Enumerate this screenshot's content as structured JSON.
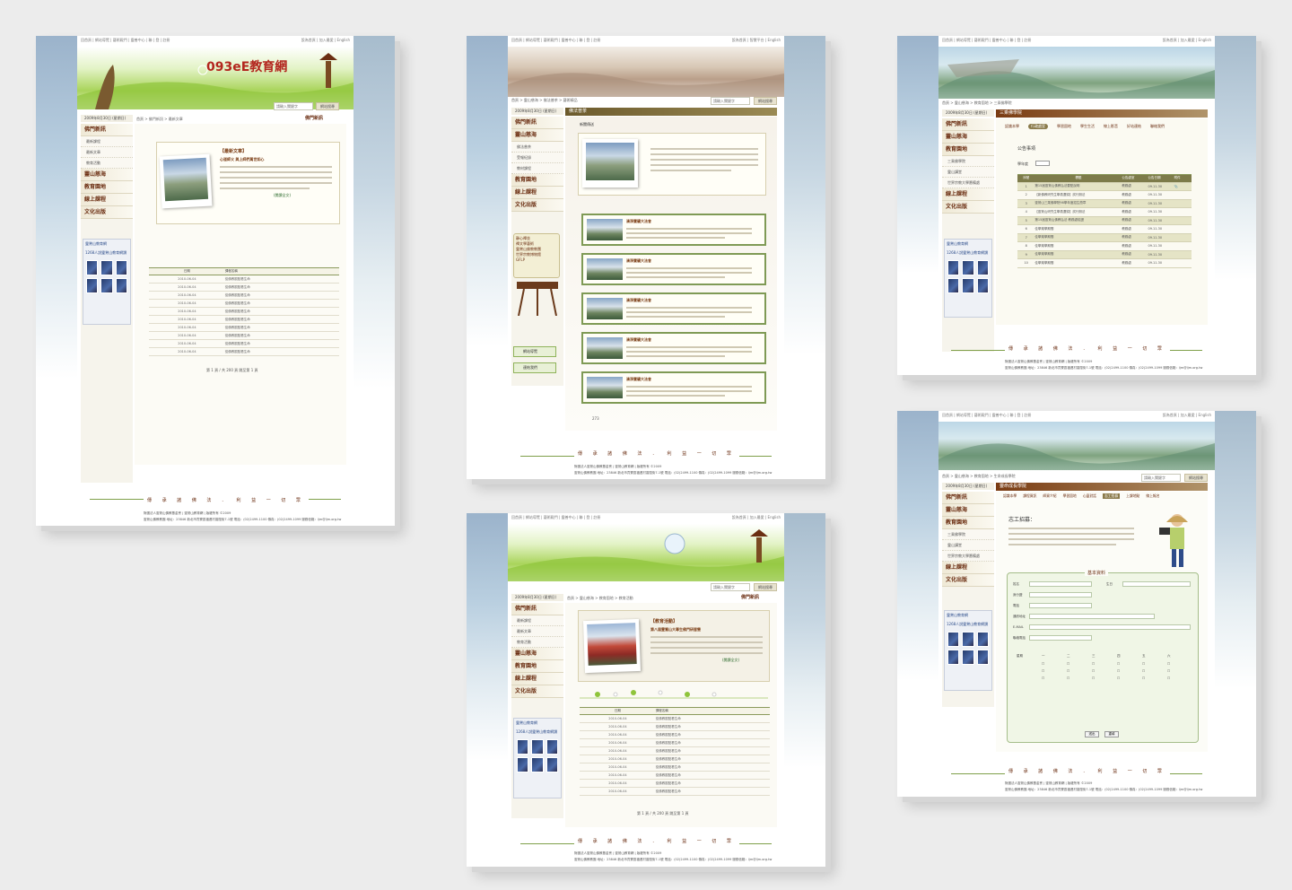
{
  "topnav": {
    "links": "回首頁 | 網站導覽 | 藝術殿門 | 靈善中心 | 聯 | 登 | 註冊",
    "links_short": "回首頁 | 網站導覽 | 藝術殿門 | 靈善中心 | 聯 | 登 | 註冊",
    "right": "設為首頁 | 加入最愛 | English",
    "right_alt": "設為首頁 | 智慧平台 | English"
  },
  "site": {
    "logo_text": "093eE教育網"
  },
  "search": {
    "placeholder": "請輸入關鍵字",
    "button": "網站搜尋"
  },
  "date": "2009年8月30日 (星期日)",
  "sidebar": {
    "menu1": "佛門新訊",
    "sub1": [
      "最新課程",
      "最新文章",
      "教育活動"
    ],
    "menu2": "靈山慈海",
    "menu3": "教育園地",
    "menu4": "線上課程",
    "menu5": "文化出版"
  },
  "facebook": {
    "title": "靈鷲山教育網",
    "sub": "Facebook",
    "like": "讚",
    "fans": "1268人說靈鷲山教育網讚",
    "fan_name": "有緣的"
  },
  "page1": {
    "crumb": "首頁 > 佛門新訊 > 最新文章",
    "badge": "佛門新訊",
    "article_title": "【最新文章】",
    "article_sub": "心道師父 與上師們萬世如心",
    "more": "(閱讀全文)",
    "table_head": [
      "日期",
      "課程名稱"
    ],
    "rows": [
      [
        "2010-06-04",
        "從佛教觀點看生命"
      ],
      [
        "2010-06-04",
        "從佛教觀點看生命"
      ],
      [
        "2010-06-04",
        "從佛教觀點看生命"
      ],
      [
        "2010-06-04",
        "從佛教觀點看生命"
      ],
      [
        "2010-06-04",
        "從佛教觀點看生命"
      ],
      [
        "2010-06-04",
        "從佛教觀點看生命"
      ],
      [
        "2010-06-04",
        "從佛教觀點看生命"
      ],
      [
        "2010-06-04",
        "從佛教觀點看生命"
      ],
      [
        "2010-06-04",
        "從佛教觀點看生命"
      ],
      [
        "2010-06-04",
        "從佛教觀點看生命"
      ]
    ],
    "pager": "第 1 頁 / 共 200 頁     跳至第 1 頁"
  },
  "page2": {
    "crumb": "首頁 > 靈山慈海 > 佛法普茶 > 藝術精品",
    "tab": "佛法普茶",
    "subhead": "新聞傳送",
    "sub_menu": [
      "佛法普茶",
      "受報紀錄",
      "教材課程"
    ],
    "news_title": "清淨寶礦大法會",
    "side_notes": [
      "靜心禪坐",
      "禪文學藝術",
      "靈鷲山佛教教團",
      "世界宗教博物館",
      "GFLP"
    ],
    "buttons": [
      "網站導覽",
      "連結我們"
    ],
    "rows_count": "273"
  },
  "page3": {
    "crumb": "首頁 > 靈山慈海 > 教育園地 > 三乘佛學院",
    "tab": "三乘佛學院",
    "tabs": [
      "認識本學",
      "行政處室",
      "學習園地",
      "學生生活",
      "線上影音",
      "好站連結",
      "聯絡我們"
    ],
    "section": "公告事項",
    "filter_label": "學年度",
    "side_menu": [
      "三乘佛學院",
      "靈山講堂",
      "世界宗教大學籌備處"
    ],
    "table_head": [
      "序號",
      "標題",
      "公告處室",
      "公告日期",
      "附件"
    ],
    "rows": [
      [
        "1",
        "第15屆靈鷲山佛教弘法要點說明",
        "教務處",
        "09.11.30"
      ],
      [
        "2",
        "【新佛教研究生學員選錄】試行辦法",
        "教務處",
        "09.11.30"
      ],
      [
        "3",
        "靈鷲山三乘佛學院98學年度招生簡章",
        "教務處",
        "09.11.30"
      ],
      [
        "4",
        "【靈鷲山研究生學員選錄】試行辦法",
        "教務處",
        "09.11.30"
      ],
      [
        "5",
        "第15屆靈鷲山佛教弘法 教務處檢證",
        "教務處",
        "09.11.30"
      ],
      [
        "6",
        "佳學樂學期間",
        "教務處",
        "09.11.30"
      ],
      [
        "7",
        "佳學樂學期間",
        "教務處",
        "09.11.30"
      ],
      [
        "8",
        "佳學樂學期間",
        "教務處",
        "09.11.30"
      ],
      [
        "9",
        "佳學樂學期間",
        "教務處",
        "09.11.30"
      ],
      [
        "10",
        "佳學樂學期間",
        "教務處",
        "09.11.30"
      ]
    ]
  },
  "page4": {
    "crumb": "首頁 > 靈山慈海 > 教育園地 > 教育活動",
    "badge": "佛門新訊",
    "article_title": "【教育活動】",
    "article_sub": "第八屆靈鷲山大專生佛門研習營",
    "more": "(閱讀全文)",
    "table_head": [
      "日期",
      "課程名稱"
    ],
    "pager": "第 1 頁 / 共 200 頁     跳至第 1 頁"
  },
  "page5": {
    "crumb": "首頁 > 靈山慈海 > 教育園地 > 生命成長學院",
    "tab": "靈命成長學院",
    "tabs": [
      "認識本學",
      "課程資訊",
      "師資介紹",
      "學習園地",
      "心靈對話",
      "志工招募",
      "上課地點",
      "線上報名"
    ],
    "heading": "志工招募：",
    "form_title": "基本資料",
    "fields": [
      "姓名",
      "生日",
      "身分證",
      "電話",
      "通訊地址",
      "E-MAIL",
      "聯絡電話"
    ],
    "schedule_days": [
      "星期",
      "一",
      "二",
      "三",
      "四",
      "五",
      "六"
    ],
    "submit": "送出",
    "reset": "重填"
  },
  "footer": {
    "motto": "傳 承 諸 佛 法 ． 利 益 一 切 眾",
    "line1": "財團法人靈鷲山佛教基金會 | 靈鷲山教育網 | 版權所有 ©2009",
    "line2": "靈鷲山佛教教團  地址：23846 新北市貢寮區福連村香蘭街7-1號  電話：(02)2499-1100  傳真：(02)2499-1099  服務信箱：ljm@ljm.org.tw"
  }
}
